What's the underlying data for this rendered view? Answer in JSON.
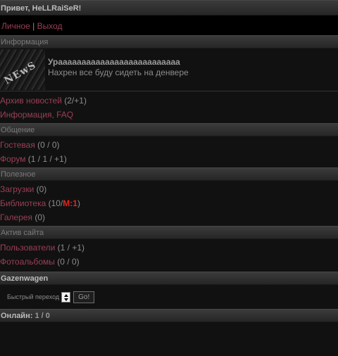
{
  "greeting": "Привет, HeLLRaiSeR!",
  "account": {
    "personal": "Личное",
    "divider": "|",
    "logout": "Выход"
  },
  "info": {
    "header": "Информация",
    "news_logo": "NEwS",
    "news_title": "Урaaaaaaaaaaaaaaaaaaaaaaaaaa",
    "news_text": "Нахрен все буду сидеть на денвере",
    "archive_link": "Архив новостей",
    "archive_count": "(2/+1)",
    "faq_link": "Информация, FAQ"
  },
  "communication": {
    "header": "Общение",
    "guestbook": "Гостевая",
    "guestbook_count": "(0 / 0)",
    "forum": "Форум",
    "forum_count": "(1 / 1 / +1)"
  },
  "useful": {
    "header": "Полезное",
    "downloads": "Загрузки",
    "downloads_count": "(0)",
    "library": "Библиотека",
    "library_count": "(10/",
    "library_mod": "M:1",
    "library_close": ")",
    "gallery": "Галерея",
    "gallery_count": "(0)"
  },
  "activity": {
    "header": "Актив сайта",
    "users": "Пользователи",
    "users_count": "(1 / +1)",
    "albums": "Фотоальбомы",
    "albums_count": "(0 / 0)"
  },
  "gazenwagen": {
    "header": "Gazenwagen",
    "quick_label": "Быстрый переход",
    "go_label": "Go!"
  },
  "online": {
    "label": "Онлайн:",
    "value": "1 / 0"
  }
}
